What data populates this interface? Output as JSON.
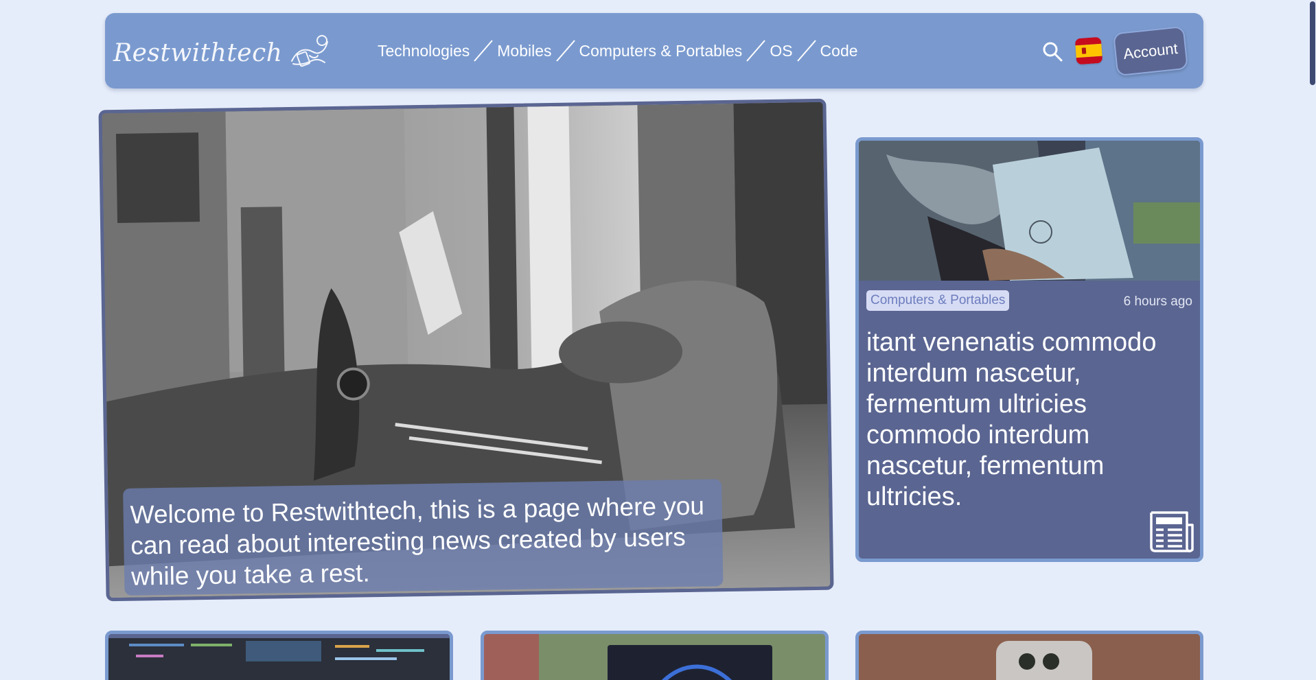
{
  "header": {
    "logo_text": "Restwithtech",
    "nav": [
      {
        "label": "Technologies"
      },
      {
        "label": "Mobiles"
      },
      {
        "label": "Computers & Portables"
      },
      {
        "label": "OS"
      },
      {
        "label": "Code"
      }
    ],
    "search_icon": "search-icon",
    "language_flag": "spain-flag-icon",
    "account_label": "Account"
  },
  "hero": {
    "caption": "Welcome to Restwithtech, this is a page where you can read about interesting news created by users while you take a rest."
  },
  "featured": {
    "category": "Computers & Portables",
    "time": "6 hours ago",
    "title": "itant venenatis commodo interdum nascetur, fermentum ultricies commodo interdum nascetur, fermentum ultricies.",
    "icon": "newspaper-icon"
  },
  "colors": {
    "header_bg": "#7a9acf",
    "card_bg": "#5a6591",
    "page_bg": "#e6edfa",
    "badge_bg": "#d7dcf5"
  }
}
